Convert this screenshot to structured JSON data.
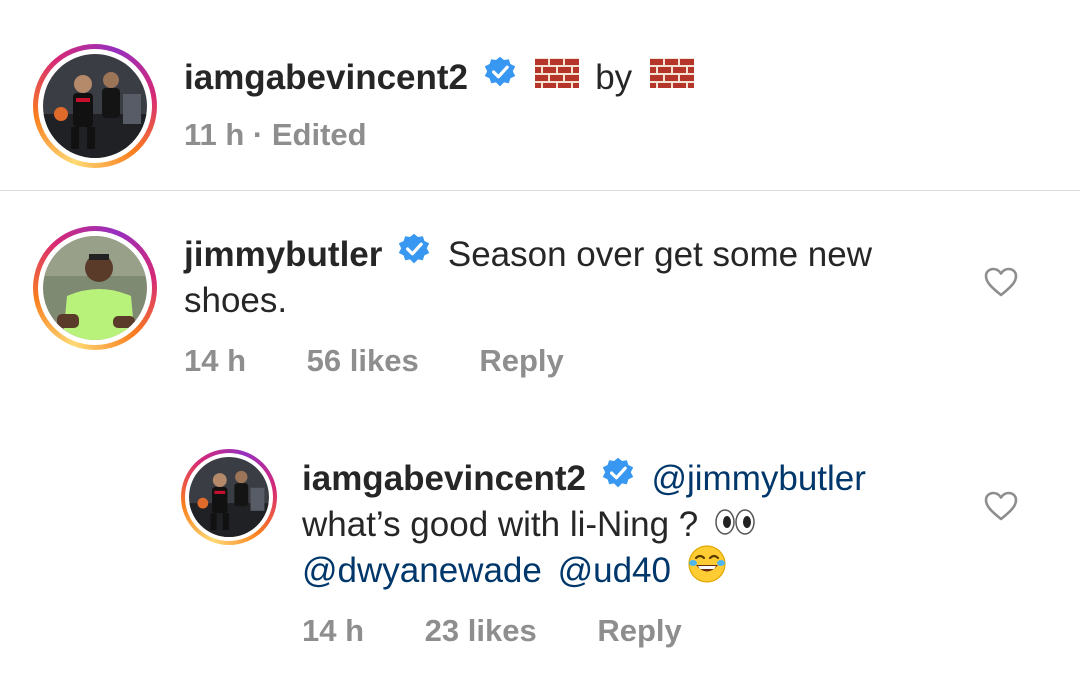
{
  "post": {
    "username": "iamgabevincent2",
    "caption_middle": "by",
    "meta": "11 h · Edited"
  },
  "comment1": {
    "username": "jimmybutler",
    "text_line1": "Season over get some new",
    "text_line2": "shoes.",
    "time": "14 h",
    "likes": "56 likes",
    "reply": "Reply"
  },
  "reply1": {
    "username": "iamgabevincent2",
    "mention1": "@jimmybutler",
    "text_line2": "what’s good with li-Ning ?",
    "mention2": "@dwyanewade",
    "mention3": "@ud40",
    "time": "14 h",
    "likes": "23 likes",
    "reply": "Reply"
  },
  "colors": {
    "verified": "#3897f0",
    "mention": "#00376b",
    "meta": "#8e8e8e"
  },
  "icons": [
    "verified-badge-icon",
    "brick-emoji-icon",
    "heart-icon",
    "eyes-emoji-icon",
    "laughing-emoji-icon"
  ]
}
